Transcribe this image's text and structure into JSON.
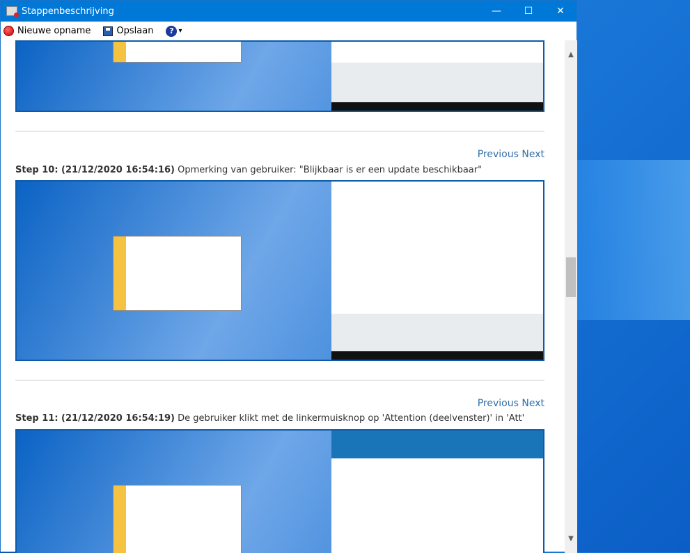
{
  "window": {
    "title": "Stappenbeschrijving",
    "minimize": "—",
    "maximize": "☐",
    "close": "✕"
  },
  "toolbar": {
    "new_recording": "Nieuwe opname",
    "save": "Opslaan",
    "help": "?",
    "help_dropdown": "▾"
  },
  "steps": [
    {
      "label": "Step 10: (21/12/2020 16:54:16)",
      "text": "Opmerking van gebruiker: \"Blijkbaar is er een update beschikbaar\"",
      "previous": "Previous",
      "next": "Next"
    },
    {
      "label": "Step 11: (21/12/2020 16:54:19)",
      "text": "De gebruiker klikt met de linkermuisknop op 'Attention (deelvenster)' in 'Att'",
      "previous": "Previous",
      "next": "Next"
    }
  ]
}
